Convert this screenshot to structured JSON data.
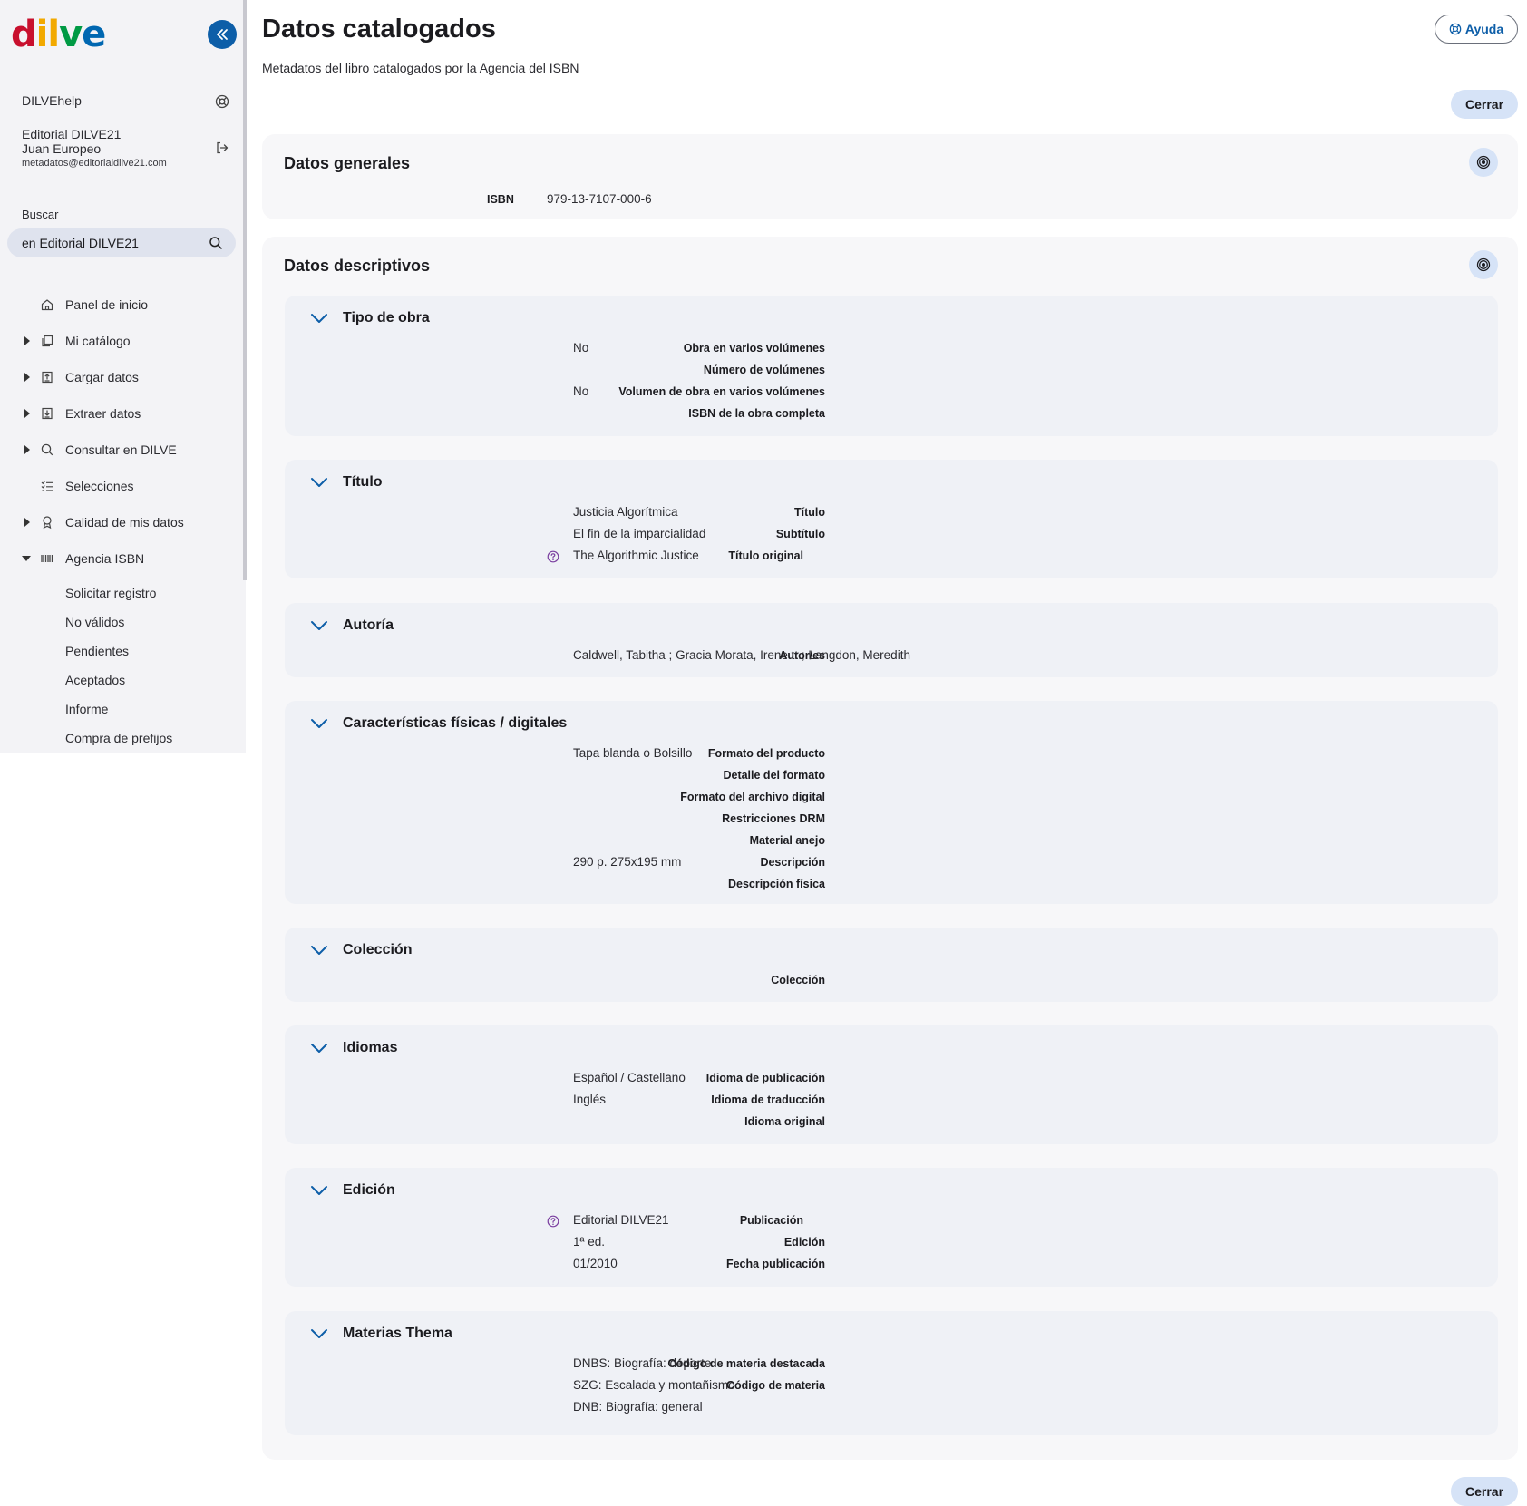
{
  "brand": {
    "logo_letters": [
      "d",
      "i",
      "l",
      "v",
      "e"
    ]
  },
  "sidebar": {
    "help_label": "DILVEhelp",
    "publisher": "Editorial DILVE21",
    "user": "Juan Europeo",
    "email": "metadatos@editorialdilve21.com",
    "search_label": "Buscar",
    "search_value": "en Editorial DILVE21",
    "nav": [
      {
        "label": "Panel de inicio",
        "icon": "home-icon",
        "caret": "none"
      },
      {
        "label": "Mi catálogo",
        "icon": "books-icon",
        "caret": "right"
      },
      {
        "label": "Cargar datos",
        "icon": "upload-icon",
        "caret": "right"
      },
      {
        "label": "Extraer datos",
        "icon": "download-icon",
        "caret": "right"
      },
      {
        "label": "Consultar en DILVE",
        "icon": "search-icon",
        "caret": "right"
      },
      {
        "label": "Selecciones",
        "icon": "checklist-icon",
        "caret": "none"
      },
      {
        "label": "Calidad de mis datos",
        "icon": "award-icon",
        "caret": "right"
      },
      {
        "label": "Agencia ISBN",
        "icon": "barcode-icon",
        "caret": "down"
      }
    ],
    "subnav": [
      "Solicitar registro",
      "No válidos",
      "Pendientes",
      "Aceptados",
      "Informe",
      "Compra de prefijos"
    ]
  },
  "header": {
    "title": "Datos catalogados",
    "subtitle": "Metadatos del libro catalogados por la Agencia del ISBN",
    "help_button": "Ayuda",
    "close_button": "Cerrar"
  },
  "general": {
    "title": "Datos generales",
    "isbn_label": "ISBN",
    "isbn_value": "979-13-7107-000-6"
  },
  "descriptive": {
    "title": "Datos descriptivos",
    "sections": [
      {
        "title": "Tipo de obra",
        "fields": [
          {
            "label": "Obra en varios volúmenes",
            "value": "No"
          },
          {
            "label": "Número de volúmenes",
            "value": ""
          },
          {
            "label": "Volumen de obra en varios volúmenes",
            "value": "No"
          },
          {
            "label": "ISBN de la obra completa",
            "value": ""
          }
        ]
      },
      {
        "title": "Título",
        "fields": [
          {
            "label": "Título",
            "value": "Justicia Algorítmica"
          },
          {
            "label": "Subtítulo",
            "value": "El fin de la imparcialidad"
          },
          {
            "label": "Título original",
            "value": "The Algorithmic Justice",
            "help": true
          }
        ]
      },
      {
        "title": "Autoría",
        "fields": [
          {
            "label": "Autor/es",
            "value": "Caldwell, Tabitha ; Gracia Morata, Irene tr.; Langdon, Meredith"
          }
        ]
      },
      {
        "title": "Características físicas / digitales",
        "fields": [
          {
            "label": "Formato del producto",
            "value": "Tapa blanda o Bolsillo"
          },
          {
            "label": "Detalle del formato",
            "value": ""
          },
          {
            "label": "Formato del archivo digital",
            "value": ""
          },
          {
            "label": "Restricciones DRM",
            "value": ""
          },
          {
            "label": "Material anejo",
            "value": ""
          },
          {
            "label": "Descripción",
            "value": "290 p. 275x195 mm"
          },
          {
            "label": "Descripción física",
            "value": ""
          }
        ]
      },
      {
        "title": "Colección",
        "fields": [
          {
            "label": "Colección",
            "value": ""
          }
        ]
      },
      {
        "title": "Idiomas",
        "fields": [
          {
            "label": "Idioma de publicación",
            "value": "Español / Castellano"
          },
          {
            "label": "Idioma de traducción",
            "value": "Inglés"
          },
          {
            "label": "Idioma original",
            "value": ""
          }
        ]
      },
      {
        "title": "Edición",
        "fields": [
          {
            "label": "Publicación",
            "value": "Editorial DILVE21",
            "help": true
          },
          {
            "label": "Edición",
            "value": "1ª ed."
          },
          {
            "label": "Fecha publicación",
            "value": "01/2010"
          }
        ]
      },
      {
        "title": "Materias Thema",
        "fields": [
          {
            "label": "Código de materia destacada",
            "value": "DNBS: Biografía: deporte"
          },
          {
            "label": "Código de materia",
            "value": "SZG: Escalada y montañismo"
          },
          {
            "label": "",
            "value": "DNB: Biografía: general"
          }
        ]
      }
    ]
  },
  "colors": {
    "primary": "#0d5ea8",
    "button_bg": "#d6e3f7",
    "card_bg": "#eff1f6",
    "sidebar_bg": "#f3f3f6",
    "help_icon": "#7b3fa0"
  }
}
